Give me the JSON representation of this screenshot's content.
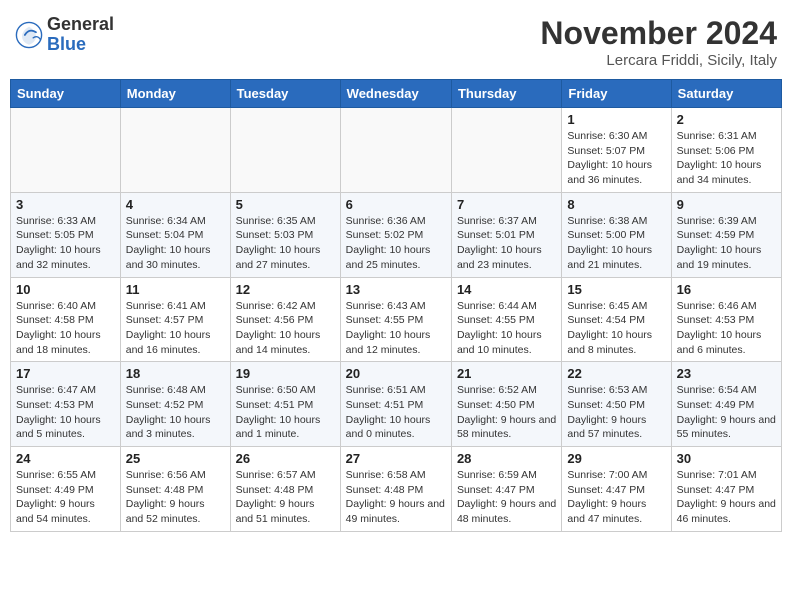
{
  "logo": {
    "general": "General",
    "blue": "Blue"
  },
  "title": "November 2024",
  "location": "Lercara Friddi, Sicily, Italy",
  "weekdays": [
    "Sunday",
    "Monday",
    "Tuesday",
    "Wednesday",
    "Thursday",
    "Friday",
    "Saturday"
  ],
  "weeks": [
    [
      {
        "day": "",
        "info": ""
      },
      {
        "day": "",
        "info": ""
      },
      {
        "day": "",
        "info": ""
      },
      {
        "day": "",
        "info": ""
      },
      {
        "day": "",
        "info": ""
      },
      {
        "day": "1",
        "info": "Sunrise: 6:30 AM\nSunset: 5:07 PM\nDaylight: 10 hours and 36 minutes."
      },
      {
        "day": "2",
        "info": "Sunrise: 6:31 AM\nSunset: 5:06 PM\nDaylight: 10 hours and 34 minutes."
      }
    ],
    [
      {
        "day": "3",
        "info": "Sunrise: 6:33 AM\nSunset: 5:05 PM\nDaylight: 10 hours and 32 minutes."
      },
      {
        "day": "4",
        "info": "Sunrise: 6:34 AM\nSunset: 5:04 PM\nDaylight: 10 hours and 30 minutes."
      },
      {
        "day": "5",
        "info": "Sunrise: 6:35 AM\nSunset: 5:03 PM\nDaylight: 10 hours and 27 minutes."
      },
      {
        "day": "6",
        "info": "Sunrise: 6:36 AM\nSunset: 5:02 PM\nDaylight: 10 hours and 25 minutes."
      },
      {
        "day": "7",
        "info": "Sunrise: 6:37 AM\nSunset: 5:01 PM\nDaylight: 10 hours and 23 minutes."
      },
      {
        "day": "8",
        "info": "Sunrise: 6:38 AM\nSunset: 5:00 PM\nDaylight: 10 hours and 21 minutes."
      },
      {
        "day": "9",
        "info": "Sunrise: 6:39 AM\nSunset: 4:59 PM\nDaylight: 10 hours and 19 minutes."
      }
    ],
    [
      {
        "day": "10",
        "info": "Sunrise: 6:40 AM\nSunset: 4:58 PM\nDaylight: 10 hours and 18 minutes."
      },
      {
        "day": "11",
        "info": "Sunrise: 6:41 AM\nSunset: 4:57 PM\nDaylight: 10 hours and 16 minutes."
      },
      {
        "day": "12",
        "info": "Sunrise: 6:42 AM\nSunset: 4:56 PM\nDaylight: 10 hours and 14 minutes."
      },
      {
        "day": "13",
        "info": "Sunrise: 6:43 AM\nSunset: 4:55 PM\nDaylight: 10 hours and 12 minutes."
      },
      {
        "day": "14",
        "info": "Sunrise: 6:44 AM\nSunset: 4:55 PM\nDaylight: 10 hours and 10 minutes."
      },
      {
        "day": "15",
        "info": "Sunrise: 6:45 AM\nSunset: 4:54 PM\nDaylight: 10 hours and 8 minutes."
      },
      {
        "day": "16",
        "info": "Sunrise: 6:46 AM\nSunset: 4:53 PM\nDaylight: 10 hours and 6 minutes."
      }
    ],
    [
      {
        "day": "17",
        "info": "Sunrise: 6:47 AM\nSunset: 4:53 PM\nDaylight: 10 hours and 5 minutes."
      },
      {
        "day": "18",
        "info": "Sunrise: 6:48 AM\nSunset: 4:52 PM\nDaylight: 10 hours and 3 minutes."
      },
      {
        "day": "19",
        "info": "Sunrise: 6:50 AM\nSunset: 4:51 PM\nDaylight: 10 hours and 1 minute."
      },
      {
        "day": "20",
        "info": "Sunrise: 6:51 AM\nSunset: 4:51 PM\nDaylight: 10 hours and 0 minutes."
      },
      {
        "day": "21",
        "info": "Sunrise: 6:52 AM\nSunset: 4:50 PM\nDaylight: 9 hours and 58 minutes."
      },
      {
        "day": "22",
        "info": "Sunrise: 6:53 AM\nSunset: 4:50 PM\nDaylight: 9 hours and 57 minutes."
      },
      {
        "day": "23",
        "info": "Sunrise: 6:54 AM\nSunset: 4:49 PM\nDaylight: 9 hours and 55 minutes."
      }
    ],
    [
      {
        "day": "24",
        "info": "Sunrise: 6:55 AM\nSunset: 4:49 PM\nDaylight: 9 hours and 54 minutes."
      },
      {
        "day": "25",
        "info": "Sunrise: 6:56 AM\nSunset: 4:48 PM\nDaylight: 9 hours and 52 minutes."
      },
      {
        "day": "26",
        "info": "Sunrise: 6:57 AM\nSunset: 4:48 PM\nDaylight: 9 hours and 51 minutes."
      },
      {
        "day": "27",
        "info": "Sunrise: 6:58 AM\nSunset: 4:48 PM\nDaylight: 9 hours and 49 minutes."
      },
      {
        "day": "28",
        "info": "Sunrise: 6:59 AM\nSunset: 4:47 PM\nDaylight: 9 hours and 48 minutes."
      },
      {
        "day": "29",
        "info": "Sunrise: 7:00 AM\nSunset: 4:47 PM\nDaylight: 9 hours and 47 minutes."
      },
      {
        "day": "30",
        "info": "Sunrise: 7:01 AM\nSunset: 4:47 PM\nDaylight: 9 hours and 46 minutes."
      }
    ]
  ]
}
